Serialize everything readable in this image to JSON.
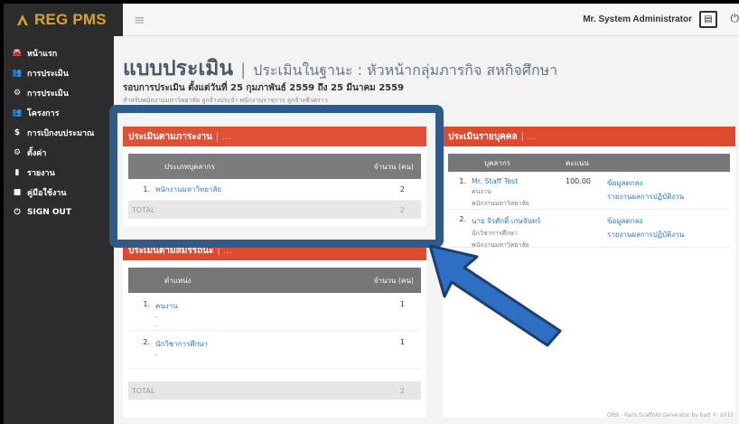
{
  "brand": {
    "name": "REG PMS"
  },
  "header": {
    "user_name": "Mr. System Administrator"
  },
  "sidebar": {
    "items": [
      {
        "label": "หน้าแรก",
        "icon": "car-icon"
      },
      {
        "label": "การประเมิน",
        "icon": "users-icon"
      },
      {
        "label": "การประเมิน",
        "icon": "cogs-icon"
      },
      {
        "label": "โครงการ",
        "icon": "users-icon"
      },
      {
        "label": "การเบิกงบประมาณ",
        "icon": "dollar-icon"
      },
      {
        "label": "ตั้งค่า",
        "icon": "cogs-icon"
      },
      {
        "label": "รายงาน",
        "icon": "bar-chart-icon"
      },
      {
        "label": "คู่มือใช้งาน",
        "icon": "book-icon"
      },
      {
        "label": "SIGN OUT",
        "icon": "power-icon"
      }
    ]
  },
  "page": {
    "title": "แบบประเมิน",
    "subtitle": "ประเมินในฐานะ : หัวหน้ากลุ่มภารกิจ สหกิจศึกษา",
    "round": "รอบการประเมิน ตั้งแต่วันที่ 25 กุมภาพันธ์ 2559 ถึง 25 มีนาคม 2559",
    "note": "สำหรับพนักงานมหาวิทยาลัย ลูกจ้างประจำ พนักงานราชการ ลูกจ้างชั่วคราว"
  },
  "workload_panel": {
    "title": "ประเมินตามภาระงาน",
    "suffix": "| ...",
    "columns": [
      "ประเภทบุคลากร",
      "จำนวน (คน)"
    ],
    "rows": [
      {
        "num": "1.",
        "name": "พนักงานมหาวิทยาลัย",
        "count": "2"
      }
    ],
    "total_label": "TOTAL",
    "total_value": "2"
  },
  "competency_panel": {
    "title": "ประเมินตามสมรรถนะ",
    "suffix": "| ...",
    "columns": [
      "ตำแหน่ง",
      "จำนวน (คน)"
    ],
    "rows": [
      {
        "num": "1.",
        "name": "คนงาน",
        "sub1": "-",
        "sub2": "-",
        "count": "1"
      },
      {
        "num": "2.",
        "name": "นักวิชาการศึกษา",
        "sub1": "-",
        "sub2": "",
        "count": "1"
      }
    ],
    "total_label": "TOTAL",
    "total_value": "2"
  },
  "individual_panel": {
    "title": "ประเมินรายบุคคล",
    "suffix": "| ...",
    "columns": [
      "บุคลากร",
      "คะแนน"
    ],
    "rows": [
      {
        "num": "1.",
        "name": "Mr. Staff Test",
        "sub1": "คนงาน",
        "sub2": "พนักงานมหาวิทยาลัย",
        "score": "100.00",
        "link1": "ข้อมูลตกลง",
        "link2": "รายงานผลการปฏิบัติงาน"
      },
      {
        "num": "2.",
        "name": "นาย จิรศักดิ์ เกษจันทร์",
        "sub1": "นักวิชาการศึกษา",
        "sub2": "พนักงานมหาวิทยาลัย",
        "score": "",
        "link1": "ข้อมูลตกลง",
        "link2": "รายงานผลการปฏิบัติงาน"
      }
    ]
  },
  "footer": {
    "text": "ORB - Rails Scaffold Generator by batt © 2015"
  },
  "colors": {
    "accent_red": "#dd4a2e",
    "sidebar": "#2c2c2c",
    "brand_gold": "#d9a32a",
    "highlight_blue": "#2e5a8c",
    "link": "#2a7cc7"
  }
}
